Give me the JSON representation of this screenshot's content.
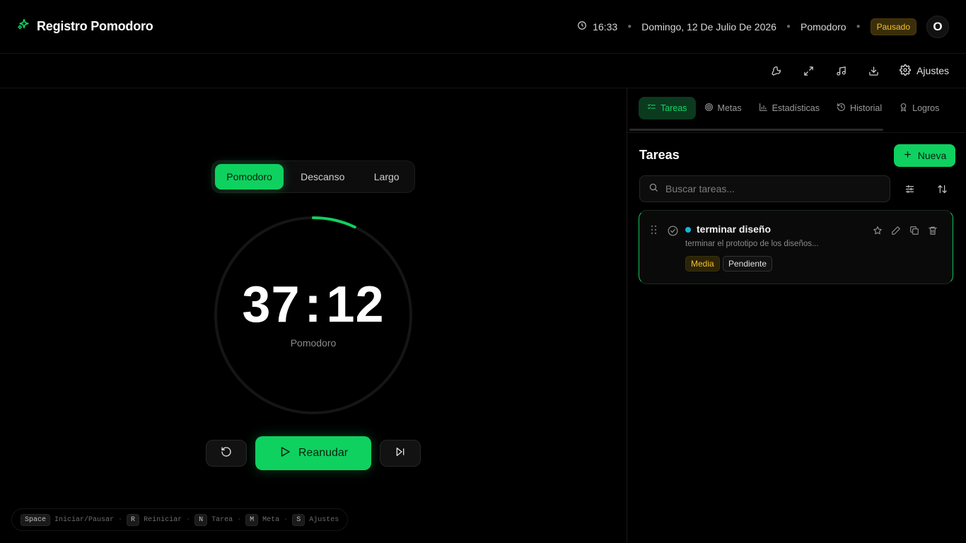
{
  "header": {
    "app_title": "Registro Pomodoro",
    "time": "16:33",
    "date": "Domingo, 12 De Julio De 2026",
    "mode": "Pomodoro",
    "status_badge": "Pausado",
    "avatar_initial": "O"
  },
  "toolbar": {
    "icons": [
      "wrench-icon",
      "expand-icon",
      "music-icon",
      "download-icon"
    ],
    "settings_label": "Ajustes"
  },
  "timer": {
    "modes": [
      "Pomodoro",
      "Descanso",
      "Largo"
    ],
    "active_mode": "Pomodoro",
    "minutes": "37",
    "separator": ":",
    "seconds": "12",
    "label": "Pomodoro",
    "progress_fraction": 0.07,
    "resume_label": "Reanudar"
  },
  "shortcuts": [
    {
      "key": "Space",
      "label": "Iniciar/Pausar"
    },
    {
      "key": "R",
      "label": "Reiniciar"
    },
    {
      "key": "N",
      "label": "Tarea"
    },
    {
      "key": "M",
      "label": "Meta"
    },
    {
      "key": "S",
      "label": "Ajustes"
    }
  ],
  "panel": {
    "tabs": [
      "Tareas",
      "Metas",
      "Estadísticas",
      "Historial",
      "Logros"
    ],
    "active_tab": "Tareas",
    "title": "Tareas",
    "new_label": "Nueva",
    "search_placeholder": "Buscar tareas...",
    "tasks": [
      {
        "name": "terminar diseño",
        "description": "terminar el prototipo de los diseños...",
        "priority": "Media",
        "status": "Pendiente"
      }
    ]
  },
  "colors": {
    "accent": "#0fd160",
    "background": "#000000",
    "warning": "#f2c12e",
    "task_dot": "#13b6d6"
  }
}
